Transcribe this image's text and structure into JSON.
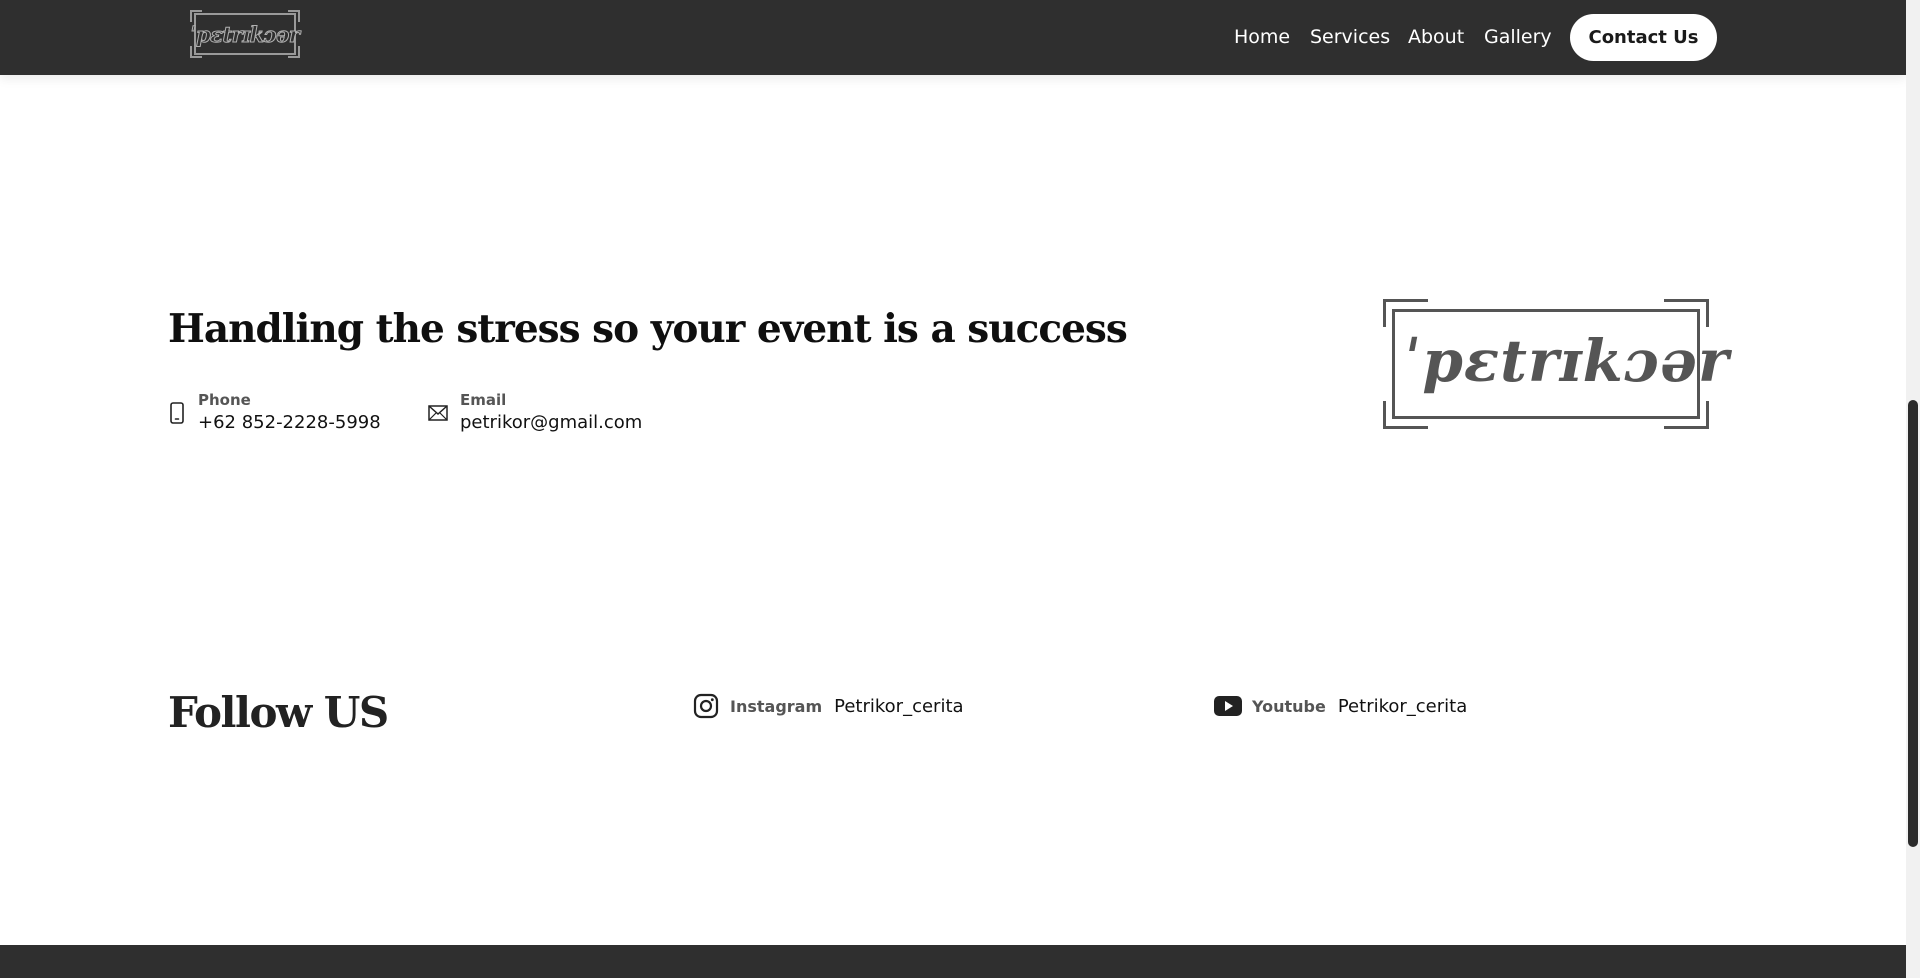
{
  "header": {
    "logo_text": "ˈpɛtrɪkɔər",
    "nav": [
      {
        "label": "Home"
      },
      {
        "label": "Services"
      },
      {
        "label": "About"
      },
      {
        "label": "Gallery"
      }
    ],
    "cta_label": "Contact Us"
  },
  "hero": {
    "headline": "Handling the stress so your event is a success",
    "phone": {
      "label": "Phone",
      "value": "+62 852-2228-5998",
      "icon": "phone-icon"
    },
    "email": {
      "label": "Email",
      "value": "petrikor@gmail.com",
      "icon": "mail-icon"
    },
    "logo_text": "ˈpɛtrɪkɔər"
  },
  "follow": {
    "title": "Follow US",
    "socials": [
      {
        "name": "Instagram",
        "handle": "Petrikor_cerita",
        "icon": "instagram-icon"
      },
      {
        "name": "Youtube",
        "handle": "Petrikor_cerita",
        "icon": "youtube-icon"
      }
    ]
  },
  "colors": {
    "header_bg": "#2f2f2f",
    "text_dark": "#111111",
    "label_gray": "#555555",
    "logo_gray": "#555555"
  }
}
